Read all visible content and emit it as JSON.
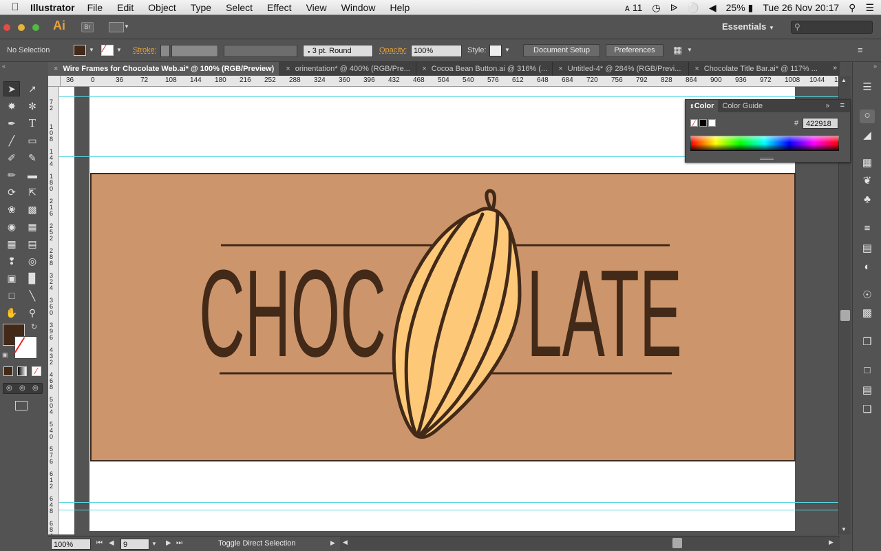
{
  "menubar": {
    "app": "Illustrator",
    "items": [
      "File",
      "Edit",
      "Object",
      "Type",
      "Select",
      "Effect",
      "View",
      "Window",
      "Help"
    ],
    "status": {
      "adobe_count": "11",
      "battery": "25%",
      "datetime": "Tue 26 Nov  20:17"
    }
  },
  "appbar": {
    "logo": "Ai",
    "bridge": "Br",
    "workspace": "Essentials"
  },
  "control": {
    "selection": "No Selection",
    "stroke_label": "Stroke:",
    "brush": "3 pt. Round",
    "opacity_label": "Opacity:",
    "opacity_value": "100%",
    "style_label": "Style:",
    "document_setup": "Document Setup",
    "preferences": "Preferences"
  },
  "tabs": [
    {
      "label": "Wire Frames for Chocolate Web.ai* @ 100% (RGB/Preview)",
      "active": true
    },
    {
      "label": "orinentation* @ 400% (RGB/Pre...",
      "active": false
    },
    {
      "label": "Cocoa Bean Button.ai @ 316% (...",
      "active": false
    },
    {
      "label": "Untitled-4* @ 284% (RGB/Previ...",
      "active": false
    },
    {
      "label": "Chocolate Title Bar.ai* @ 117% ...",
      "active": false
    }
  ],
  "ruler": {
    "h_ticks": [
      "36",
      "0",
      "36",
      "72",
      "108",
      "144",
      "180",
      "216",
      "252",
      "288",
      "324",
      "360",
      "396",
      "432",
      "468",
      "504",
      "540",
      "576",
      "612",
      "648",
      "684",
      "720",
      "756",
      "792",
      "828",
      "864",
      "900",
      "936",
      "972",
      "1008",
      "1044",
      "1"
    ],
    "v_ticks": [
      "7\n2",
      "1\n0\n8",
      "1\n4\n4",
      "1\n8\n0",
      "2\n1\n6",
      "2\n5\n2",
      "2\n8\n8",
      "3\n2\n4",
      "3\n6\n0",
      "3\n9\n6",
      "4\n3\n2",
      "4\n6\n8",
      "5\n0\n4",
      "5\n4\n0",
      "5\n7\n6",
      "6\n1\n2",
      "6\n4\n8",
      "6\n8\n4"
    ]
  },
  "artwork": {
    "word_left": "CHOC",
    "word_right": "LATE",
    "text_color": "#422918",
    "banner_color": "#cc956b",
    "pod_color": "#fdc979"
  },
  "colorPanel": {
    "tab_color": "Color",
    "tab_guide": "Color Guide",
    "hash": "#",
    "hex": "422918"
  },
  "status": {
    "zoom": "100%",
    "artboard": "9",
    "tool_hint": "Toggle Direct Selection"
  },
  "colors": {
    "fill": "#422918",
    "accent": "#e8a13a"
  }
}
